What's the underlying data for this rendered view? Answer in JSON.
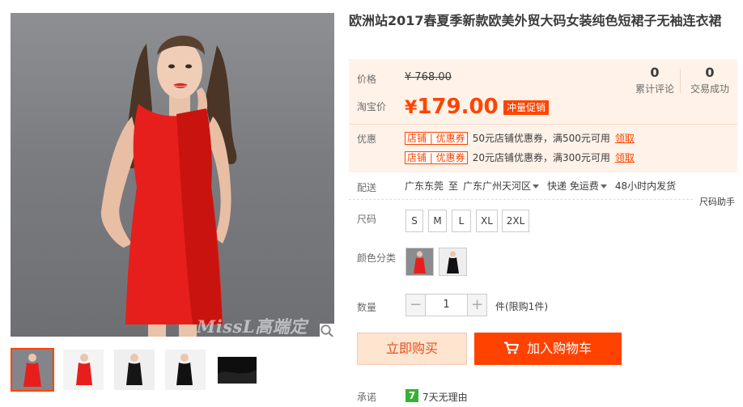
{
  "gallery": {
    "watermark": "MissL高端定",
    "zoom_icon": "search-icon",
    "thumbnails": [
      "red-dress-front",
      "red-dress-side",
      "black-dress-front",
      "black-dress-side",
      "black-fabric-detail"
    ]
  },
  "product": {
    "title": "欧洲站2017春夏季新款欧美外贸大码女装纯色短裙子无袖连衣裙"
  },
  "price": {
    "price_label": "价格",
    "original_price": "¥ 768.00",
    "taobao_label": "淘宝价",
    "currency": "¥",
    "amount": "179.00",
    "promo_tag": "冲量促销",
    "reviews_count": "0",
    "reviews_label": "累计评论",
    "sales_count": "0",
    "sales_label": "交易成功"
  },
  "coupons": {
    "label": "优惠",
    "items": [
      {
        "tag": "店铺 | 优惠券",
        "text": "50元店铺优惠券，满500元可用",
        "action": "领取"
      },
      {
        "tag": "店铺 | 优惠券",
        "text": "20元店铺优惠券，满300元可用",
        "action": "领取"
      }
    ]
  },
  "delivery": {
    "label": "配送",
    "from": "广东东莞",
    "to_word": "至",
    "destination": "广东广州天河区",
    "shipping": "快递 免运费",
    "dispatch": "48小时内发货"
  },
  "size": {
    "label": "尺码",
    "help": "尺码助手",
    "options": [
      "S",
      "M",
      "L",
      "XL",
      "2XL"
    ]
  },
  "color": {
    "label": "颜色分类",
    "options": [
      "red",
      "black"
    ]
  },
  "quantity": {
    "label": "数量",
    "minus": "−",
    "value": "1",
    "plus": "+",
    "unit": "件(限购1件)"
  },
  "actions": {
    "buy_now": "立即购买",
    "add_to_cart": "加入购物车"
  },
  "promise": {
    "label": "承诺",
    "icon_text": "7",
    "text": "7天无理由"
  },
  "colors": {
    "accent": "#ff4400",
    "price_bg": "#fff2e8",
    "dress_red": "#e8201f",
    "promise_green": "#34b233"
  }
}
